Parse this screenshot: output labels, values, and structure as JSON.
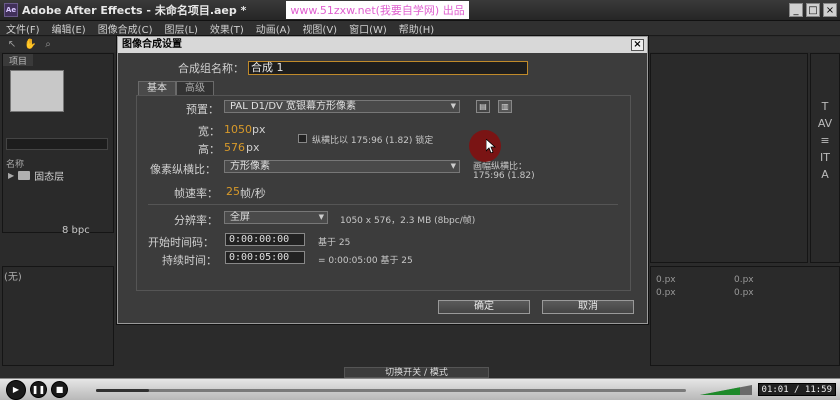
{
  "window": {
    "title": "Adobe After Effects - 未命名项目.aep *",
    "watermark": "www.51zxw.net(我要自学网) 出品",
    "icon_text": "Ae",
    "controls": [
      "_",
      "□",
      "×"
    ]
  },
  "menu": [
    "文件(F)",
    "编辑(E)",
    "图像合成(C)",
    "图层(L)",
    "效果(T)",
    "动画(A)",
    "视图(V)",
    "窗口(W)",
    "帮助(H)"
  ],
  "background": {
    "project_tab": "项目",
    "column_name": "名称",
    "folder": "固态层",
    "bpc": "8 bpc",
    "timeline_label": "(无)",
    "px_labels": [
      "0.px",
      "0.px",
      "0.px",
      "0.px"
    ],
    "switch_label": "切换开关 / 模式",
    "right_tools": [
      "T",
      "AV",
      "≡",
      "IT",
      "A"
    ]
  },
  "dialog": {
    "title": "图像合成设置",
    "close": "×",
    "name_label": "合成组名称：",
    "name_value": "合成 1",
    "tabs": [
      "基本",
      "高级"
    ],
    "preset_label": "预置：",
    "preset_value": "PAL D1/DV 宽银幕方形像素",
    "width_label": "宽：",
    "width_value": "1050",
    "height_label": "高：",
    "height_value": "576",
    "unit_px": "px",
    "lock_ratio_label": "纵横比以 175:96 (1.82) 锁定",
    "pixel_aspect_label": "像素纵横比：",
    "pixel_aspect_value": "方形像素",
    "frame_aspect_title": "画幅纵横比：",
    "frame_aspect_value": "175:96 (1.82)",
    "framerate_label": "帧速率：",
    "framerate_value": "25",
    "framerate_unit": "帧/秒",
    "resolution_label": "分辨率：",
    "resolution_value": "全屏",
    "resolution_info": "1050 x 576，2.3 MB (8bpc/帧)",
    "start_tc_label": "开始时间码：",
    "start_tc_value": "0:00:00:00",
    "start_tc_base": "基于 25",
    "duration_label": "持续时间：",
    "duration_value": "0:00:05:00",
    "duration_info": "= 0:00:05:00  基于 25",
    "ok": "确定",
    "cancel": "取消"
  },
  "player": {
    "time": "01:01 / 11:59",
    "progress": 0.09
  }
}
